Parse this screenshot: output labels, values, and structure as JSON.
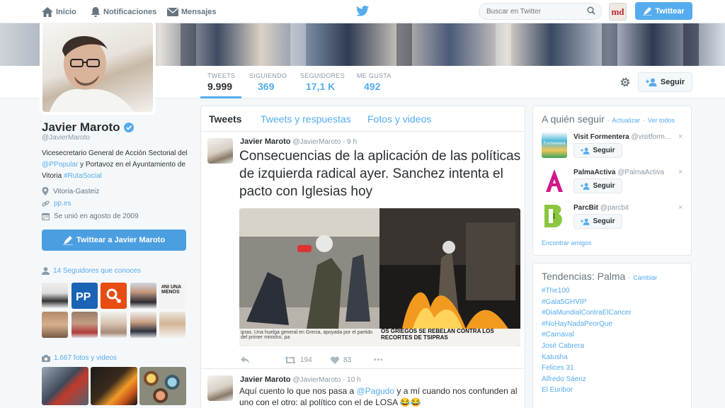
{
  "nav": {
    "home": "Inicio",
    "notifications": "Notificaciones",
    "messages": "Mensajes",
    "search_placeholder": "Buscar en Twitter",
    "avatar_text": "md",
    "tweet_button": "Twittear"
  },
  "stats": [
    {
      "label": "TWEETS",
      "value": "9.999"
    },
    {
      "label": "SIGUIENDO",
      "value": "369"
    },
    {
      "label": "SEGUIDORES",
      "value": "17,1 K"
    },
    {
      "label": "ME GUSTA",
      "value": "492"
    }
  ],
  "follow_button": "Seguir",
  "profile": {
    "name": "Javier Maroto",
    "handle": "@JavierMaroto",
    "bio_1": "Vicesecretario General de Acción Sectorial del ",
    "bio_mention": "@PPopular",
    "bio_2": " y Portavoz en el Ayuntamiento de Vitoria ",
    "bio_hashtag": "#RutaSocial",
    "location": "Vitoria-Gasteiz",
    "url": "pp.es",
    "joined": "Se unió en agosto de 2009",
    "tweet_to": "Twittear a Javier Maroto",
    "followers_you_know": "14 Seguidores que conoces",
    "photos_videos": "1.667 fotos y videos"
  },
  "tabs": [
    "Tweets",
    "Tweets y respuestas",
    "Fotos y videos"
  ],
  "tweets": [
    {
      "name": "Javier Maroto",
      "handle": "@JavierMaroto",
      "time": "· 9 h",
      "text": "Consecuencias de la aplicación de las políticas de izquierda radical ayer. Sanchez intenta el pacto con Iglesias hoy",
      "retweets": "194",
      "likes": "83",
      "more": "•••",
      "image_caption_left": "ipras. Una huelga general en Grecia, apoyada por el partido del primer ministro, pa",
      "image_caption_right": "OS GRIEGOS SE REBELAN CONTRA LOS RECORTES DE TSIPRAS"
    },
    {
      "name": "Javier Maroto",
      "handle": "@JavierMaroto",
      "time": "· 10 h",
      "text_1": "Aquí cuento lo que nos pasa a ",
      "mention": "@Pagudo",
      "text_2": " y a mí cuando nos confunden al uno con el otro: al político con el de LOSA 😂😂"
    }
  ],
  "who_to_follow": {
    "title": "A quién seguir",
    "refresh": "Actualizar",
    "view_all": "Ver todos",
    "items": [
      {
        "name": "Visit Formentera",
        "handle": "@visitform...",
        "logo_text": "Formentera"
      },
      {
        "name": "PalmaActiva",
        "handle": "@PalmaActiva"
      },
      {
        "name": "ParcBit",
        "handle": "@parcbit"
      }
    ],
    "find_friends": "Encontrar amigos",
    "close": "×",
    "sep": "·"
  },
  "trends": {
    "title": "Tendencias: Palma",
    "change": "Cambiar",
    "items": [
      "#The100",
      "#Gala5GHVIP",
      "#DiaMundialContraElCancer",
      "#NoHayNadaPeorQue",
      "#Carnaval",
      "José Cabrera",
      "Katusha",
      "Felices 31",
      "Alfredo Sáenz",
      "El Euribor"
    ]
  },
  "colors": {
    "accent": "#55acee",
    "text": "#292f33",
    "muted": "#8899a6"
  }
}
